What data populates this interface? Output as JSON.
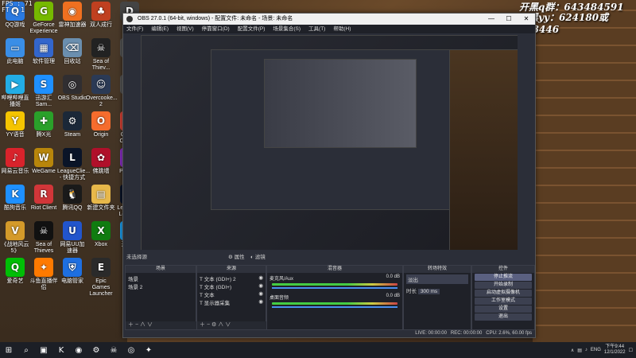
{
  "fps_counter": {
    "line1": "FPS : 71",
    "line2": "FT : 1"
  },
  "overlay": {
    "qq_group": "开黑q群：643484591",
    "yy_line": "开黑yy：624180或163446"
  },
  "desktop_icons": [
    {
      "label": "QQ游戏",
      "icon": "qqgame-icon",
      "color": "#2a7ae2",
      "glyph": "Q"
    },
    {
      "label": "GeForce Experience",
      "icon": "geforce-icon",
      "color": "#76b900",
      "glyph": "G"
    },
    {
      "label": "雷神加速器",
      "icon": "leishen-icon",
      "color": "#f07020",
      "glyph": "◉"
    },
    {
      "label": "双人成行",
      "icon": "game-icon",
      "color": "#c04020",
      "glyph": "♣"
    },
    {
      "label": "D Da",
      "icon": "dd-icon",
      "color": "#444",
      "glyph": "D"
    },
    {
      "label": "此电脑",
      "icon": "computer-icon",
      "color": "#3a8ee6",
      "glyph": "▭"
    },
    {
      "label": "软件管理",
      "icon": "software-icon",
      "color": "#3366cc",
      "glyph": "▦"
    },
    {
      "label": "回收站",
      "icon": "recycle-bin-icon",
      "color": "#6b8faf",
      "glyph": "⌫"
    },
    {
      "label": "Sea of Thiev...",
      "icon": "sea-of-thieves-icon",
      "color": "#222",
      "glyph": "☠"
    },
    {
      "label": "Pe",
      "icon": "pe-icon",
      "color": "#555",
      "glyph": "P"
    },
    {
      "label": "哔哩哔哩直播姬",
      "icon": "bilibili-icon",
      "color": "#23ade5",
      "glyph": "▶"
    },
    {
      "label": "迅游汇Sam...",
      "icon": "xunyou-icon",
      "color": "#1e90ff",
      "glyph": "S"
    },
    {
      "label": "OBS Studio",
      "icon": "obs-icon",
      "color": "#302e31",
      "glyph": "◎"
    },
    {
      "label": "Overcooke... 2",
      "icon": "overcooked-icon",
      "color": "#2b3a55",
      "glyph": "☺"
    },
    {
      "label": "M",
      "icon": "m-icon",
      "color": "#555",
      "glyph": "M"
    },
    {
      "label": "YY语音",
      "icon": "yy-icon",
      "color": "#f5c400",
      "glyph": "Y"
    },
    {
      "label": "腾X光",
      "icon": "tencent-icon",
      "color": "#2aa02a",
      "glyph": "✚"
    },
    {
      "label": "Steam",
      "icon": "steam-icon",
      "color": "#1b2838",
      "glyph": "⚙"
    },
    {
      "label": "Origin",
      "icon": "origin-icon",
      "color": "#f56c2d",
      "glyph": "O"
    },
    {
      "label": "Google Chrome",
      "icon": "chrome-icon",
      "color": "#db4437",
      "glyph": "◎"
    },
    {
      "label": "网易云音乐",
      "icon": "netease-music-icon",
      "color": "#d9232b",
      "glyph": "♪"
    },
    {
      "label": "WeGame",
      "icon": "wegame-icon",
      "color": "#b8860b",
      "glyph": "W"
    },
    {
      "label": "LeagueClie... - 快捷方式",
      "icon": "league-client-icon",
      "color": "#0a1428",
      "glyph": "L"
    },
    {
      "label": "佛跳墙",
      "icon": "fotiaoqiang-icon",
      "color": "#b0102a",
      "glyph": "✿"
    },
    {
      "label": "Pummel Party",
      "icon": "pummel-party-icon",
      "color": "#8b2fc9",
      "glyph": "P"
    },
    {
      "label": "酷狗音乐",
      "icon": "kugou-icon",
      "color": "#1e90ff",
      "glyph": "K"
    },
    {
      "label": "Riot Client",
      "icon": "riot-client-icon",
      "color": "#d13639",
      "glyph": "R"
    },
    {
      "label": "腾讯QQ",
      "icon": "qq-icon",
      "color": "#1a1a1a",
      "glyph": "🐧"
    },
    {
      "label": "新建文件夹",
      "icon": "folder-icon",
      "color": "#e8b84a",
      "glyph": "▤"
    },
    {
      "label": "League of Legends",
      "icon": "lol-icon",
      "color": "#0a1428",
      "glyph": "L"
    },
    {
      "label": "《战地风云 5》",
      "icon": "battlefield-icon",
      "color": "#d49a2a",
      "glyph": "V"
    },
    {
      "label": "Sea of Thieves",
      "icon": "sea-of-thieves-icon",
      "color": "#111",
      "glyph": "☠"
    },
    {
      "label": "网易UU加速器",
      "icon": "uu-icon",
      "color": "#2255cc",
      "glyph": "U"
    },
    {
      "label": "Xbox",
      "icon": "xbox-icon",
      "color": "#107c10",
      "glyph": "X"
    },
    {
      "label": "开黑啦",
      "icon": "kaiheila-icon",
      "color": "#1da1f2",
      "glyph": "☺"
    },
    {
      "label": "爱奇艺",
      "icon": "iqiyi-icon",
      "color": "#00be06",
      "glyph": "Q"
    },
    {
      "label": "斗鱼直播伴侣",
      "icon": "douyu-icon",
      "color": "#ff7a00",
      "glyph": "✦"
    },
    {
      "label": "电脑管家",
      "icon": "pc-manager-icon",
      "color": "#1e6fe0",
      "glyph": "⛨"
    },
    {
      "label": "Epic Games Launcher",
      "icon": "epic-icon",
      "color": "#2a2a2a",
      "glyph": "E"
    }
  ],
  "obs": {
    "title": "OBS 27.0.1 (64-bit, windows) - 配置文件: 未命名 - 场景: 未命名",
    "menu": [
      "文件(F)",
      "编辑(E)",
      "视图(V)",
      "停靠窗口(D)",
      "配置文件(P)",
      "场景集合(S)",
      "工具(T)",
      "帮助(H)"
    ],
    "status_label": "未选择源",
    "properties_label": "属性",
    "filters_label": "滤镜",
    "docks": {
      "scenes": {
        "header": "场景",
        "items": [
          "场景",
          "场景 2"
        ]
      },
      "sources": {
        "header": "来源",
        "items": [
          "文本 (GDI+) 2",
          "文本 (GDI+)",
          "文本",
          "显示器采集"
        ]
      },
      "mixer": {
        "header": "混音器",
        "channels": [
          {
            "name": "麦克风/Aux",
            "level": "0.0 dB"
          },
          {
            "name": "桌面音频",
            "level": "0.0 dB"
          }
        ]
      },
      "transitions": {
        "header": "转场特效",
        "type": "淡出",
        "duration_label": "时长",
        "duration_value": "300 ms"
      },
      "controls": {
        "header": "控件",
        "buttons": [
          "停止推流",
          "开始录制",
          "启动虚拟摄像机",
          "工作室模式",
          "设置",
          "退出"
        ]
      }
    },
    "statusbar": {
      "live": "LIVE: 00:00:00",
      "rec": "REC: 00:00:00",
      "cpu": "CPU: 2.6%, 60.00 fps"
    }
  },
  "taskbar": {
    "apps": [
      {
        "icon": "windows-start-icon",
        "glyph": "⊞"
      },
      {
        "icon": "search-icon",
        "glyph": "⌕"
      },
      {
        "icon": "task-view-icon",
        "glyph": "▣"
      },
      {
        "icon": "kugou-icon",
        "glyph": "K"
      },
      {
        "icon": "chrome-icon",
        "glyph": "◉"
      },
      {
        "icon": "steam-icon",
        "glyph": "⚙"
      },
      {
        "icon": "sea-of-thieves-icon",
        "glyph": "☠"
      },
      {
        "icon": "obs-icon",
        "glyph": "◎"
      },
      {
        "icon": "douyu-icon",
        "glyph": "✦"
      }
    ],
    "tray": {
      "lang": "ENG",
      "time": "下午9:44",
      "date": "12/1/2022"
    }
  }
}
